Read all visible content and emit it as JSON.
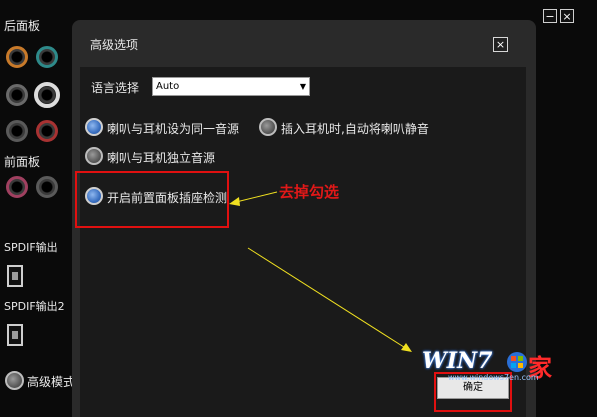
{
  "window_controls": {
    "minimize": "−",
    "close": "×"
  },
  "left_panel": {
    "back_panel_label": "后面板",
    "front_panel_label": "前面板",
    "spdif_out_label": "SPDIF输出",
    "spdif_out2_label": "SPDIF输出2",
    "advanced_mode_label": "高级模式",
    "jack_colors": {
      "orange": "#c87a2a",
      "teal": "#2e8a8a",
      "grey": "#6a6a6a",
      "white": "#dddddd",
      "red": "#a83232",
      "pink": "#a04060"
    }
  },
  "dialog": {
    "title": "高级选项",
    "close": "×",
    "language_label": "语言选择",
    "language_value": "Auto",
    "options": {
      "same_source": "喇叭与耳机设为同一音源",
      "mute_on_plug": "插入耳机时,自动将喇叭静音",
      "independent_source": "喇叭与耳机独立音源",
      "front_jack_detect": "开启前置面板插座检测"
    },
    "ok_label": "确定"
  },
  "annotation": {
    "text": "去掉勾选",
    "color": "#e01010"
  },
  "watermark": {
    "text": "WIN7",
    "char": "家",
    "url": "www.windows7en.com"
  }
}
